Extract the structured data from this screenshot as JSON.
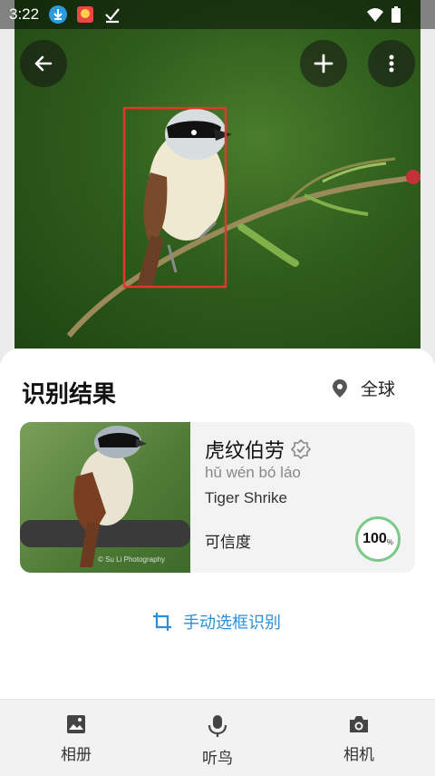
{
  "status_bar": {
    "time": "3:22"
  },
  "toolbar": {
    "back_icon": "back-arrow-icon",
    "add_icon": "plus-icon",
    "more_icon": "more-vertical-icon"
  },
  "result": {
    "title": "识别结果",
    "region": "全球",
    "species": {
      "name_cn": "虎纹伯劳",
      "pinyin": "hǔ wén bó láo",
      "name_en": "Tiger Shrike",
      "confidence_label": "可信度",
      "confidence_value": "100",
      "confidence_unit": "%"
    },
    "thumb_credit": "© Su Li Photography"
  },
  "manual_select": {
    "label": "手动选框识别"
  },
  "bottom_nav": [
    {
      "label": "相册",
      "icon": "image-icon"
    },
    {
      "label": "听鸟",
      "icon": "microphone-icon"
    },
    {
      "label": "相机",
      "icon": "camera-icon"
    }
  ],
  "colors": {
    "accent_blue": "#2a8fd8",
    "detection_box": "#e0392b",
    "confidence_ring": "#7cc98a"
  }
}
